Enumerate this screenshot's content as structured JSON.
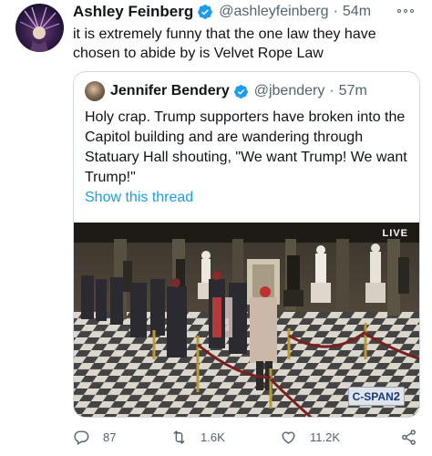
{
  "author": {
    "name": "Ashley Feinberg",
    "handle": "@ashleyfeinberg",
    "separator": "·",
    "time": "54m",
    "verified": true
  },
  "tweet": {
    "text": "it is extremely funny that the one law they have chosen to abide by is Velvet Rope Law"
  },
  "quoted": {
    "name": "Jennifer Bendery",
    "handle": "@jbendery",
    "separator": "·",
    "time": "57m",
    "verified": true,
    "text": "Holy crap. Trump supporters have broken into the Capitol building and are wandering through Statuary Hall shouting, \"We want Trump! We want Trump!\"",
    "show_thread": "Show this thread",
    "media": {
      "live_label": "LIVE",
      "network_label": "C-SPAN",
      "network_number": "2"
    }
  },
  "actions": {
    "replies": "87",
    "retweets": "1.6K",
    "likes": "11.2K"
  },
  "colors": {
    "accent": "#1d9bf0",
    "secondary_text": "#536471",
    "border": "#cfd9de"
  },
  "icons": [
    "more-icon",
    "verified-icon",
    "reply-icon",
    "retweet-icon",
    "like-icon",
    "share-icon"
  ]
}
